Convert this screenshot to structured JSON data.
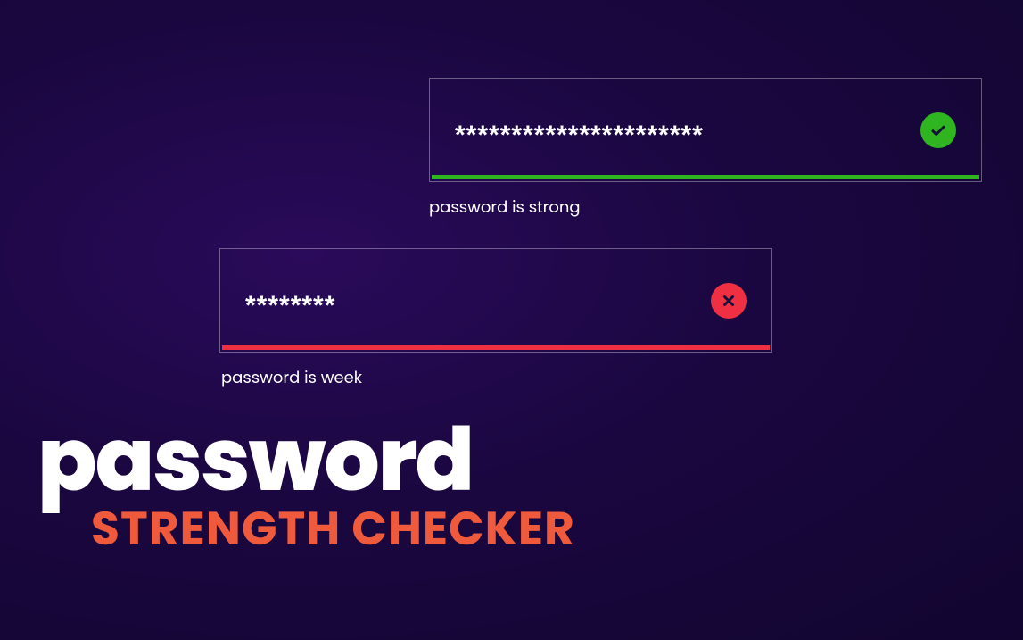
{
  "fields": {
    "strong": {
      "mask": "**********************",
      "status_text": "password is strong",
      "icon_name": "check-icon",
      "color": "#2fb51f"
    },
    "weak": {
      "mask": "********",
      "status_text": "password is week",
      "icon_name": "close-icon",
      "color": "#ee3042"
    }
  },
  "title": {
    "main": "password",
    "sub": "STRENGTH CHECKER"
  }
}
